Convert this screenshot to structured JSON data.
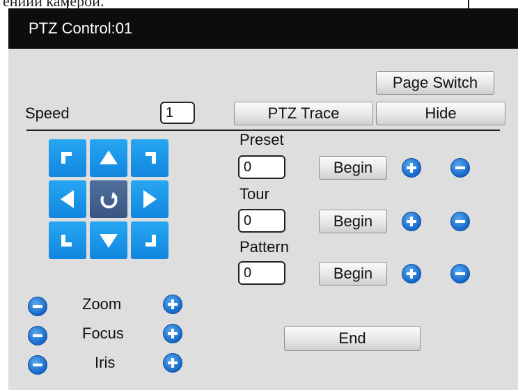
{
  "top_fragment": "ениии камерой.",
  "window": {
    "title": "PTZ Control:01"
  },
  "speed": {
    "label": "Speed",
    "value": "1"
  },
  "buttons": {
    "page_switch": "Page Switch",
    "ptz_trace": "PTZ Trace",
    "hide": "Hide",
    "end": "End"
  },
  "direction_pad": {
    "icons": [
      "arrow-up-left-icon",
      "arrow-up-icon",
      "arrow-up-right-icon",
      "arrow-left-icon",
      "rotate-icon",
      "arrow-right-icon",
      "arrow-down-left-icon",
      "arrow-down-icon",
      "arrow-down-right-icon"
    ]
  },
  "lens": [
    {
      "label": "Zoom"
    },
    {
      "label": "Focus"
    },
    {
      "label": "Iris"
    }
  ],
  "controls": [
    {
      "label": "Preset",
      "value": "0",
      "button": "Begin"
    },
    {
      "label": "Tour",
      "value": "0",
      "button": "Begin"
    },
    {
      "label": "Pattern",
      "value": "0",
      "button": "Begin"
    }
  ],
  "colors": {
    "titlebar": "#0d0d0d",
    "panel": "#dedede",
    "pad_blue": "#1a95e8",
    "pad_center": "#3f5f8c",
    "circle_blue": "#1a72d0"
  }
}
